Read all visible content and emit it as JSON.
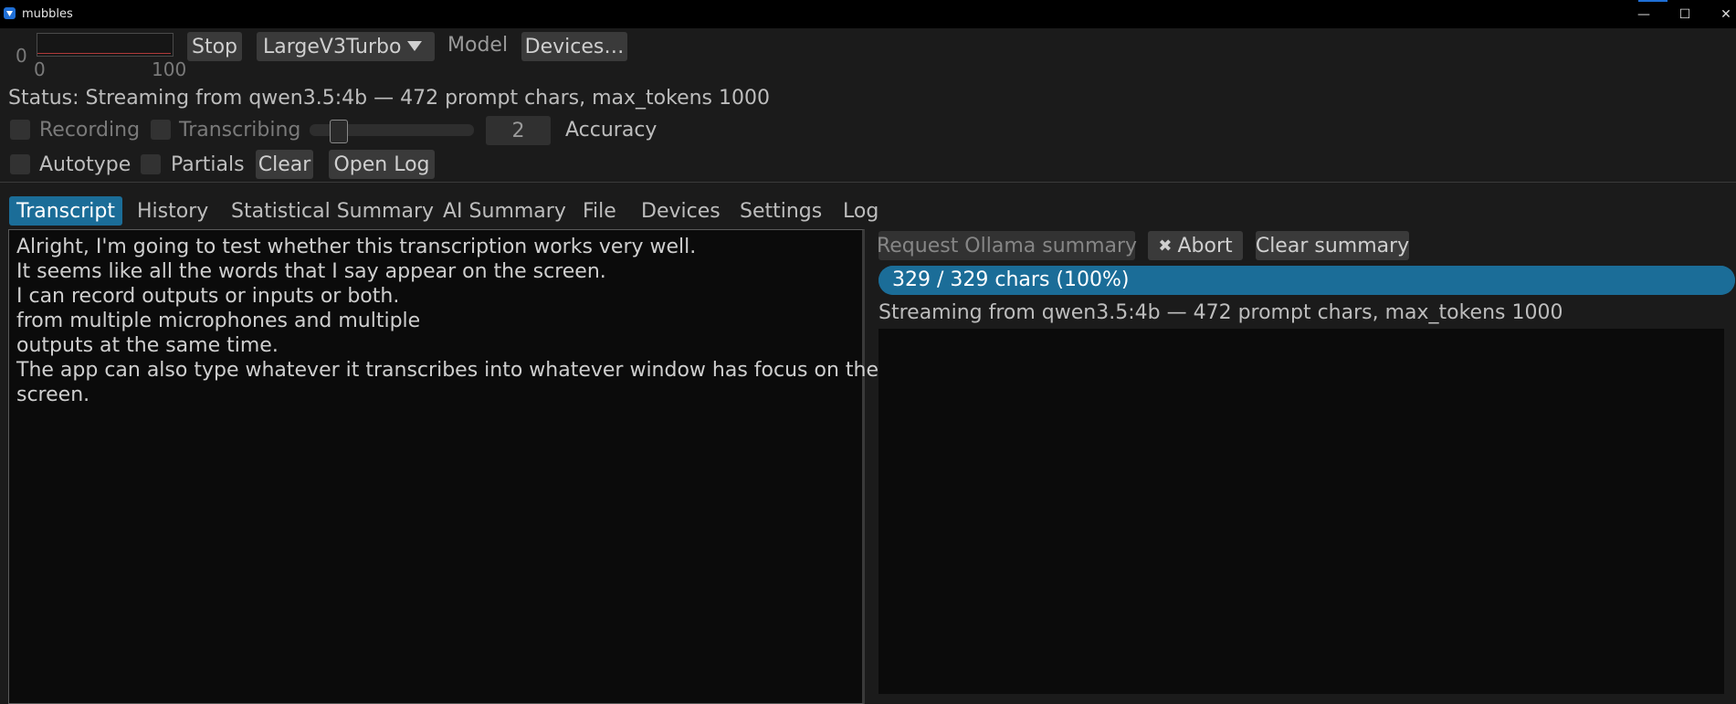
{
  "window": {
    "title": "mubbles",
    "minimize_glyph": "—",
    "maximize_glyph": "☐",
    "close_glyph": "✕"
  },
  "meter": {
    "min_label": "0",
    "axis_left": "0",
    "axis_right": "100",
    "level": 0
  },
  "toolbar": {
    "stop_label": "Stop",
    "model_select": "LargeV3Turbo",
    "model_label": "Model",
    "devices_label": "Devices…"
  },
  "status": {
    "text": "Status: Streaming from qwen3.5:4b — 472 prompt chars, max_tokens 1000"
  },
  "controls_row1": {
    "recording_label": "Recording",
    "recording_checked": false,
    "transcribing_label": "Transcribing",
    "transcribing_checked": false,
    "accuracy_value": "2",
    "accuracy_label": "Accuracy"
  },
  "controls_row2": {
    "autotype_label": "Autotype",
    "autotype_checked": false,
    "partials_label": "Partials",
    "partials_checked": false,
    "clear_label": "Clear",
    "open_log_label": "Open Log"
  },
  "tabs": [
    {
      "label": "Transcript",
      "active": true
    },
    {
      "label": "History",
      "active": false
    },
    {
      "label": "Statistical Summary",
      "active": false
    },
    {
      "label": "AI Summary",
      "active": false
    },
    {
      "label": "File",
      "active": false
    },
    {
      "label": "Devices",
      "active": false
    },
    {
      "label": "Settings",
      "active": false
    },
    {
      "label": "Log",
      "active": false
    }
  ],
  "transcript": {
    "lines": [
      "Alright, I'm going to test whether this transcription works very well.",
      "It seems like all the words that I say appear on the screen.",
      "I can record outputs or inputs or both.",
      "from multiple microphones and multiple",
      "outputs at the same time.",
      "The app can also type whatever it transcribes into whatever window has focus on the",
      "screen."
    ]
  },
  "summary": {
    "request_label": "Request Ollama summary",
    "abort_label": "Abort",
    "abort_icon": "✖",
    "clear_label": "Clear summary",
    "progress_text": "329 / 329 chars (100%)",
    "progress_fraction": 1.0,
    "streaming_text": "Streaming from qwen3.5:4b — 472 prompt chars, max_tokens 1000",
    "output": ""
  },
  "colors": {
    "background": "#1b1b1b",
    "accent": "#1b6d98",
    "meter_line": "#b03a3a",
    "text_area": "#0b0b0b"
  }
}
